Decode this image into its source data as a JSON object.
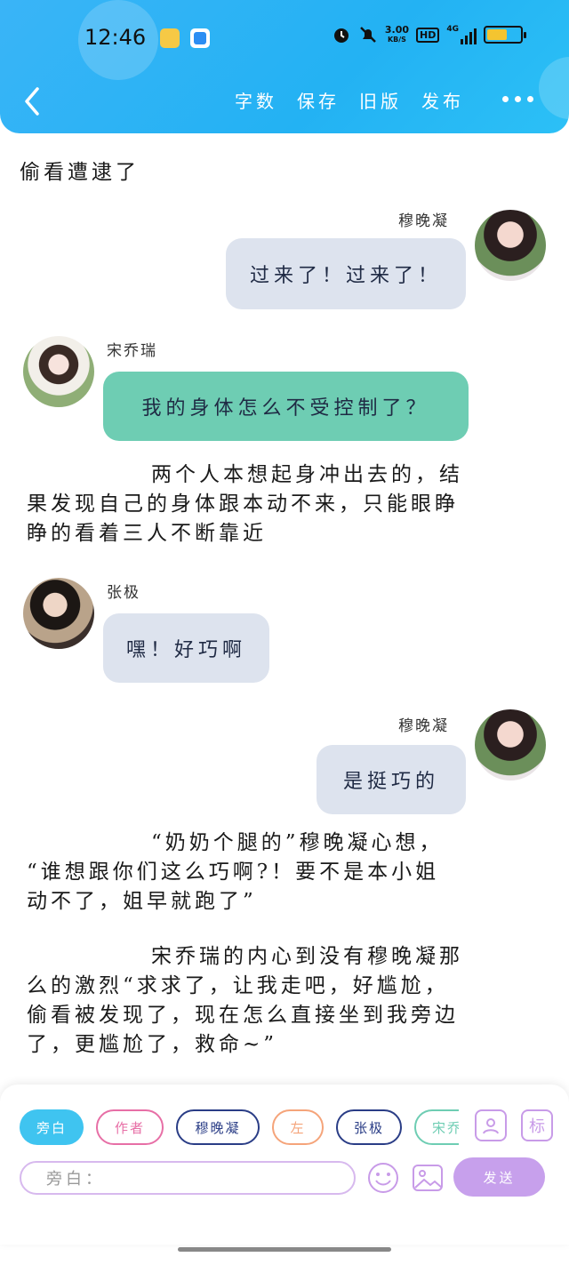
{
  "status_bar": {
    "time": "12:46",
    "speed_value": "3.00",
    "speed_unit": "KB/S",
    "hd": "HD",
    "net": "4G"
  },
  "header": {
    "actions": [
      {
        "id": "word-count",
        "label": "字数"
      },
      {
        "id": "save",
        "label": "保存"
      },
      {
        "id": "old-version",
        "label": "旧版"
      },
      {
        "id": "publish",
        "label": "发布"
      }
    ]
  },
  "content": {
    "n1": "偷看遭逮了",
    "m1": {
      "speaker": "穆晚凝",
      "text": "过来了！过来了！"
    },
    "m2": {
      "speaker": "宋乔瑞",
      "text": "我的身体怎么不受控制了？"
    },
    "n2": [
      "两个人本想起身冲出去的，结",
      "果发现自己的身体跟本动不来，只能眼睁",
      "睁的看着三人不断靠近"
    ],
    "m3": {
      "speaker": "张极",
      "text": "嘿！好巧啊"
    },
    "m4": {
      "speaker": "穆晚凝",
      "text": "是挺巧的"
    },
    "n3": [
      "“奶奶个腿的”穆晚凝心想，",
      "“谁想跟你们这么巧啊?！要不是本小姐",
      "动不了，姐早就跑了”"
    ],
    "n4": [
      "宋乔瑞的内心到没有穆晚凝那",
      "么的激烈“求求了，让我走吧，好尴尬，",
      "偷看被发现了，现在怎么直接坐到我旁边",
      "了，更尴尬了，救命~”"
    ]
  },
  "roles": [
    {
      "label": "旁白",
      "selected": true
    },
    {
      "label": "作者"
    },
    {
      "label": "穆晚凝"
    },
    {
      "label": "左"
    },
    {
      "label": "张极"
    },
    {
      "label": "宋乔"
    }
  ],
  "side_icons": {
    "tag_label": "标"
  },
  "input": {
    "placeholder": "旁白："
  },
  "send": {
    "label": "发送"
  },
  "colors": {
    "header": "#23b2f3",
    "bubble_grey": "#dde3ee",
    "bubble_teal": "#6ecdb3",
    "chip_active": "#3fc4f0",
    "chip_author": "#e76fa6",
    "chip_navy": "#2a3d86",
    "chip_left": "#f5a47a",
    "chip_teal": "#6ecdb3",
    "accent_purple": "#c7a0ec"
  }
}
